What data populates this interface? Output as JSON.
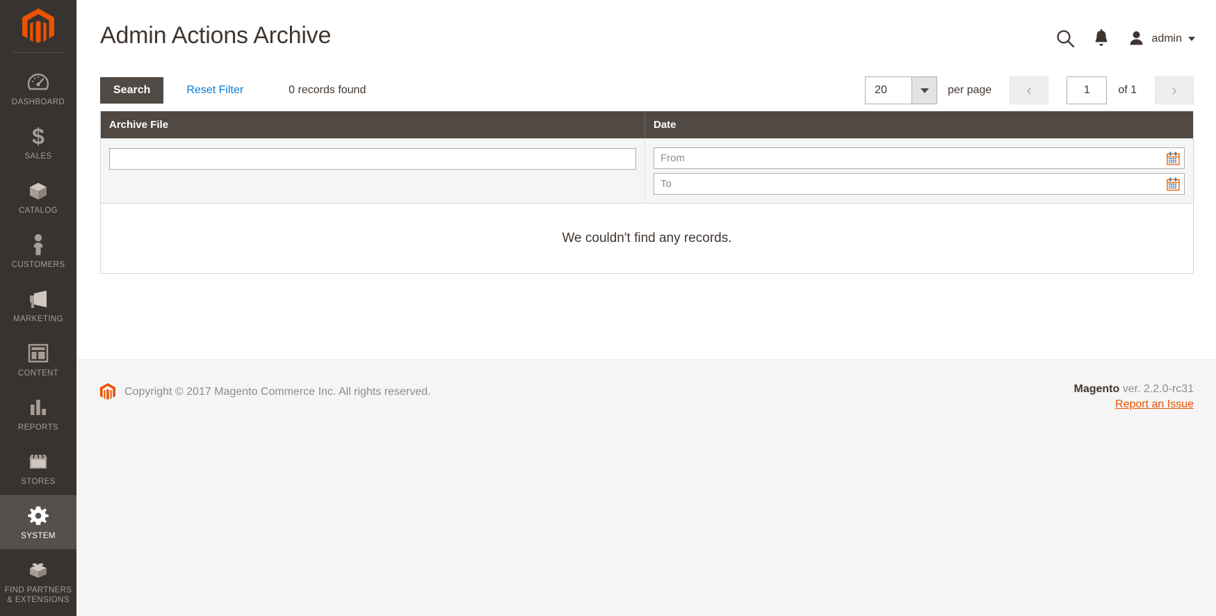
{
  "sidebar": {
    "logo_icon": "magento-logo-icon",
    "items": [
      {
        "label": "DASHBOARD",
        "icon": "gauge-icon",
        "active": false
      },
      {
        "label": "SALES",
        "icon": "dollar-icon",
        "active": false
      },
      {
        "label": "CATALOG",
        "icon": "box-icon",
        "active": false
      },
      {
        "label": "CUSTOMERS",
        "icon": "person-icon",
        "active": false
      },
      {
        "label": "MARKETING",
        "icon": "megaphone-icon",
        "active": false
      },
      {
        "label": "CONTENT",
        "icon": "layout-icon",
        "active": false
      },
      {
        "label": "REPORTS",
        "icon": "bar-chart-icon",
        "active": false
      },
      {
        "label": "STORES",
        "icon": "storefront-icon",
        "active": false
      },
      {
        "label": "SYSTEM",
        "icon": "gear-icon",
        "active": true
      },
      {
        "label": "FIND PARTNERS\n& EXTENSIONS",
        "label_line1": "FIND PARTNERS",
        "label_line2": "& EXTENSIONS",
        "icon": "blocks-icon",
        "active": false
      }
    ]
  },
  "header": {
    "title": "Admin Actions Archive",
    "search_icon": "search-icon",
    "notifications_icon": "bell-icon",
    "avatar_icon": "user-avatar-icon",
    "admin_name": "admin"
  },
  "toolbar": {
    "search_label": "Search",
    "reset_filter_label": "Reset Filter",
    "records_found": "0 records found",
    "per_page_value": "20",
    "per_page_label": "per page",
    "prev_page_icon": "chevron-left-icon",
    "next_page_icon": "chevron-right-icon",
    "current_page": "1",
    "of_pages": "of 1"
  },
  "grid": {
    "columns": [
      {
        "key": "archive_file",
        "label": "Archive File"
      },
      {
        "key": "date",
        "label": "Date"
      }
    ],
    "filters": {
      "archive_file_value": "",
      "archive_file_placeholder": "",
      "date_from_placeholder": "From",
      "date_from_value": "",
      "date_to_placeholder": "To",
      "date_to_value": "",
      "calendar_icon": "calendar-icon"
    },
    "rows": [],
    "empty_message": "We couldn't find any records."
  },
  "footer": {
    "logo_icon": "magento-logo-icon",
    "copyright": "Copyright © 2017 Magento Commerce Inc. All rights reserved.",
    "brand": "Magento",
    "version": " ver. 2.2.0-rc31",
    "report_link": "Report an Issue"
  },
  "colors": {
    "sidebar_bg": "#373330",
    "sidebar_active": "#55504c",
    "accent_orange": "#eb5202",
    "link_blue": "#007bdb",
    "header_row": "#514943"
  }
}
